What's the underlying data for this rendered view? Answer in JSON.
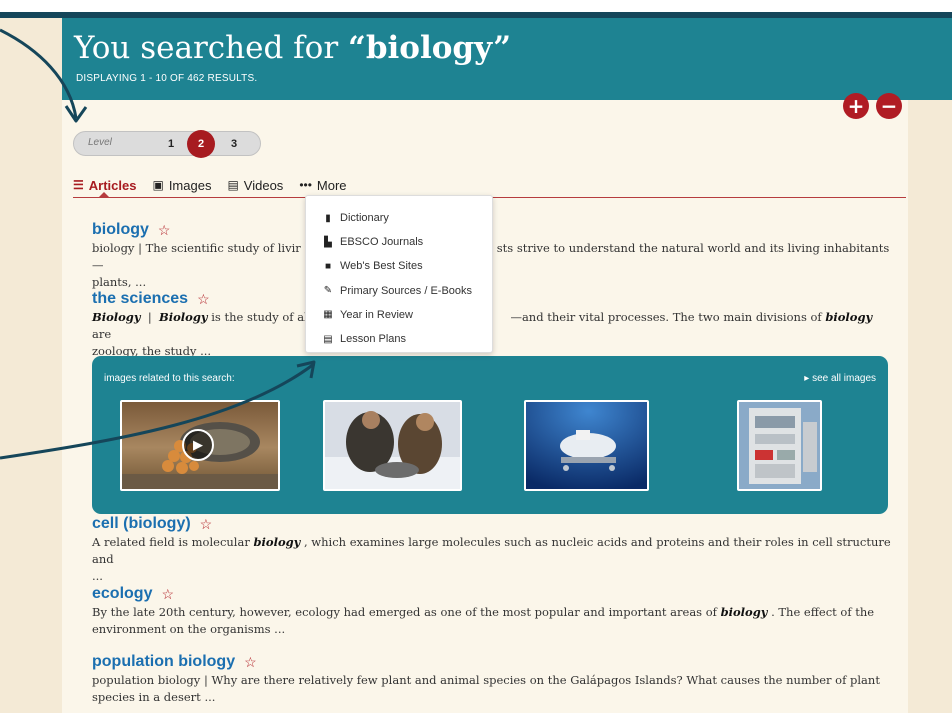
{
  "header": {
    "title_prefix": "You searched for ",
    "query_quoted": "“biology”",
    "subtitle": "DISPLAYING 1 - 10 OF 462 RESULTS."
  },
  "zoom": {
    "in_icon": "plus-icon",
    "out_icon": "minus-icon",
    "in_label": "+",
    "out_label": "−"
  },
  "level": {
    "label": "Level",
    "options": [
      "1",
      "2",
      "3"
    ],
    "selected": "2"
  },
  "tabs": [
    {
      "label": "Articles",
      "icon": "articles-icon",
      "active": true
    },
    {
      "label": "Images",
      "icon": "image-icon",
      "active": false
    },
    {
      "label": "Videos",
      "icon": "film-icon",
      "active": false
    },
    {
      "label": "More",
      "icon": "more-icon",
      "active": false
    }
  ],
  "more_menu": [
    {
      "label": "Dictionary",
      "icon": "book-icon"
    },
    {
      "label": "EBSCO Journals",
      "icon": "document-icon"
    },
    {
      "label": "Web's Best Sites",
      "icon": "bookmark-icon"
    },
    {
      "label": "Primary Sources / E-Books",
      "icon": "edit-icon"
    },
    {
      "label": "Year in Review",
      "icon": "calendar-icon"
    },
    {
      "label": "Lesson Plans",
      "icon": "list-icon"
    }
  ],
  "results": [
    {
      "title": "biology",
      "snippet_a": "biology  |  The scientific study of livir",
      "snippet_b": "sts strive to understand the natural world and its living inhabitants—",
      "snippet_c": "plants, ..."
    },
    {
      "title": "the sciences",
      "snippet_a_bold": "Biology",
      "snippet_a_sep": "  |  ",
      "snippet_a_bold2": "Biology",
      "snippet_a": " is the study of all li",
      "snippet_b1": "—and their vital processes. The two main divisions of ",
      "snippet_b_bold": "biology",
      "snippet_b2": " are",
      "snippet_c": "zoology, the study ..."
    },
    {
      "title": "cell (biology)",
      "snippet_1": "A related field is molecular ",
      "snippet_bold": "biology",
      "snippet_2": " , which examines large molecules such as nucleic acids and proteins and their roles in cell structure and",
      "snippet_3": "..."
    },
    {
      "title": "ecology",
      "snippet_1": "By the late 20th century, however, ecology had emerged as one of the most popular and important areas of ",
      "snippet_bold": "biology",
      "snippet_2": " . The effect of the",
      "snippet_3": "environment on the organisms ..."
    },
    {
      "title": "population biology",
      "snippet_1": "population biology  |  Why are there relatively few plant and animal species on the Galápagos Islands? What causes the number of plant",
      "snippet_2": "species in a desert ..."
    }
  ],
  "images_panel": {
    "label": "images related to this search:",
    "see_all": "▸ see all images",
    "thumbs": [
      {
        "name": "tortoise-eggs-video",
        "is_video": true
      },
      {
        "name": "researchers-snow",
        "is_video": false
      },
      {
        "name": "submersible-underwater",
        "is_video": false
      },
      {
        "name": "lab-equipment",
        "is_video": false
      }
    ]
  },
  "colors": {
    "header": "#1e8392",
    "accent_red": "#a71b20",
    "link_blue": "#1b6fb0",
    "background": "#f4ead6"
  }
}
